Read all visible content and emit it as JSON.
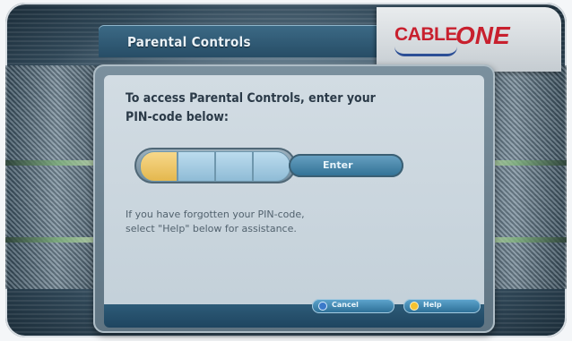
{
  "header": {
    "title": "Parental Controls"
  },
  "logo": {
    "part1": "CABLE",
    "part2": "ONE"
  },
  "dialog": {
    "prompt_line1": "To access Parental Controls, enter your",
    "prompt_line2": "PIN-code below:",
    "enter_label": "Enter",
    "help_line1": "If you have forgotten your PIN-code,",
    "help_line2": "select \"Help\" below for assistance."
  },
  "pin": {
    "length": 4,
    "entered": 0,
    "active_cell": 1
  },
  "footer": {
    "cancel_label": "Cancel",
    "help_label": "Help"
  },
  "colors": {
    "brand": "#c8202e",
    "accent": "#2f6f93",
    "pin_active": "#e4b84e"
  }
}
